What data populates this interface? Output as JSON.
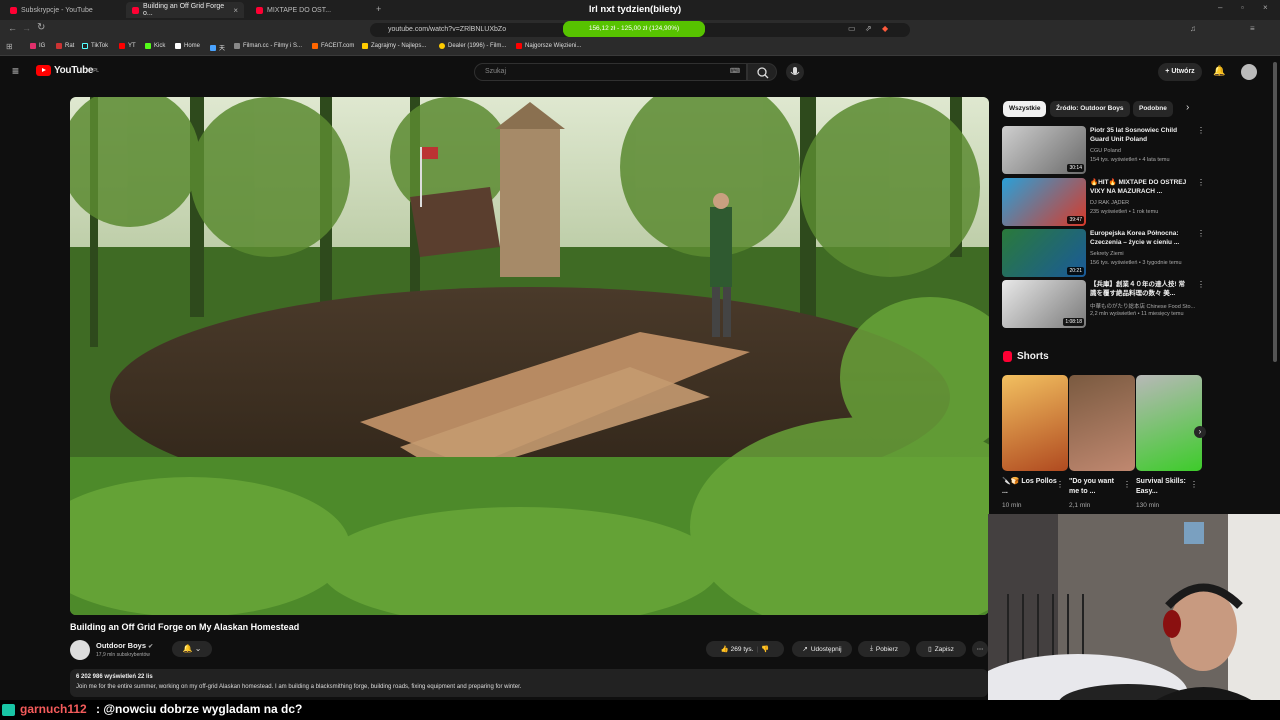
{
  "browser": {
    "tabs": [
      {
        "title": "Subskrypcje - YouTube"
      },
      {
        "title": "Building an Off Grid Forge o..."
      },
      {
        "title": "MIXTAPE DO OST..."
      }
    ],
    "url": "youtube.com/watch?v=ZRlBNLUXbZo",
    "bookmarks": [
      "IG",
      "Rat",
      "TikTok",
      "YT",
      "Kick",
      "Home",
      "天",
      "Filman.cc - Filmy i S...",
      "FACEIT.com",
      "Zagrajmy - Najleps...",
      "Dealer (1996) - Film...",
      "Najgorsze Więzieni..."
    ]
  },
  "overlay": {
    "title": "lrl nxt tydzien(bilety)",
    "goal_text": "156,12 zł - 125,00 zł (124,90%)",
    "goal_fraction": 1.0,
    "color": "#57c300"
  },
  "header": {
    "logo": "YouTube",
    "logo_region": "PL",
    "search_placeholder": "Szukaj",
    "create_label": "Utwórz"
  },
  "video": {
    "title": "Building an Off Grid Forge on My Alaskan Homestead",
    "channel": "Outdoor Boys",
    "subscribers": "17,9 mln subskrybentów",
    "likes": "269 tys.",
    "share": "Udostępnij",
    "download": "Pobierz",
    "save": "Zapisz",
    "views_line": "6 202 986 wyświetleń  22 lis",
    "description": "Join me for the entire summer, working on my off-grid Alaskan homestead. I am building a blacksmithing forge, building roads, fixing equipment and preparing for winter."
  },
  "chips": [
    "Wszystkie",
    "Źródło: Outdoor Boys",
    "Podobne"
  ],
  "recommended": [
    {
      "title": "Piotr 35 lat Sosnowiec Child Guard Unit Poland",
      "channel": "CGU Poland",
      "meta": "154 tys. wyświetleń • 4 lata temu",
      "duration": "30:14"
    },
    {
      "title": "🔥HIT🔥 MIXTAPE DO OSTREJ VIXY NA MAZURACH ...",
      "channel": "DJ RAK JĄDER",
      "meta": "235 wyświetleń • 1 rok temu",
      "duration": "39:47"
    },
    {
      "title": "Europejska Korea Północna: Czeczenia – życie w cieniu ...",
      "channel": "Sekrety Ziemi",
      "meta": "156 tys. wyświetleń • 3 tygodnie temu",
      "duration": "20:21"
    },
    {
      "title": "【兵庫】創業４０年の達人技! 常識を覆す絶品料理の数々 美...",
      "channel": "中華ものがたり総本店 Chinese Food Sto...",
      "meta": "2,2 mln wyświetleń • 11 miesięcy temu",
      "duration": "1:08:18"
    }
  ],
  "shorts": {
    "heading": "Shorts",
    "items": [
      {
        "title": "🔪🍞 Los Pollos ...",
        "views": "10 mln"
      },
      {
        "title": "\"Do you want me to ...",
        "views": "2,1 mln"
      },
      {
        "title": "Survival Skills: Easy...",
        "views": "130 mln"
      }
    ]
  },
  "chat": {
    "user": "garnuch112",
    "message": ": @nowciu dobrze wygladam na dc?"
  }
}
